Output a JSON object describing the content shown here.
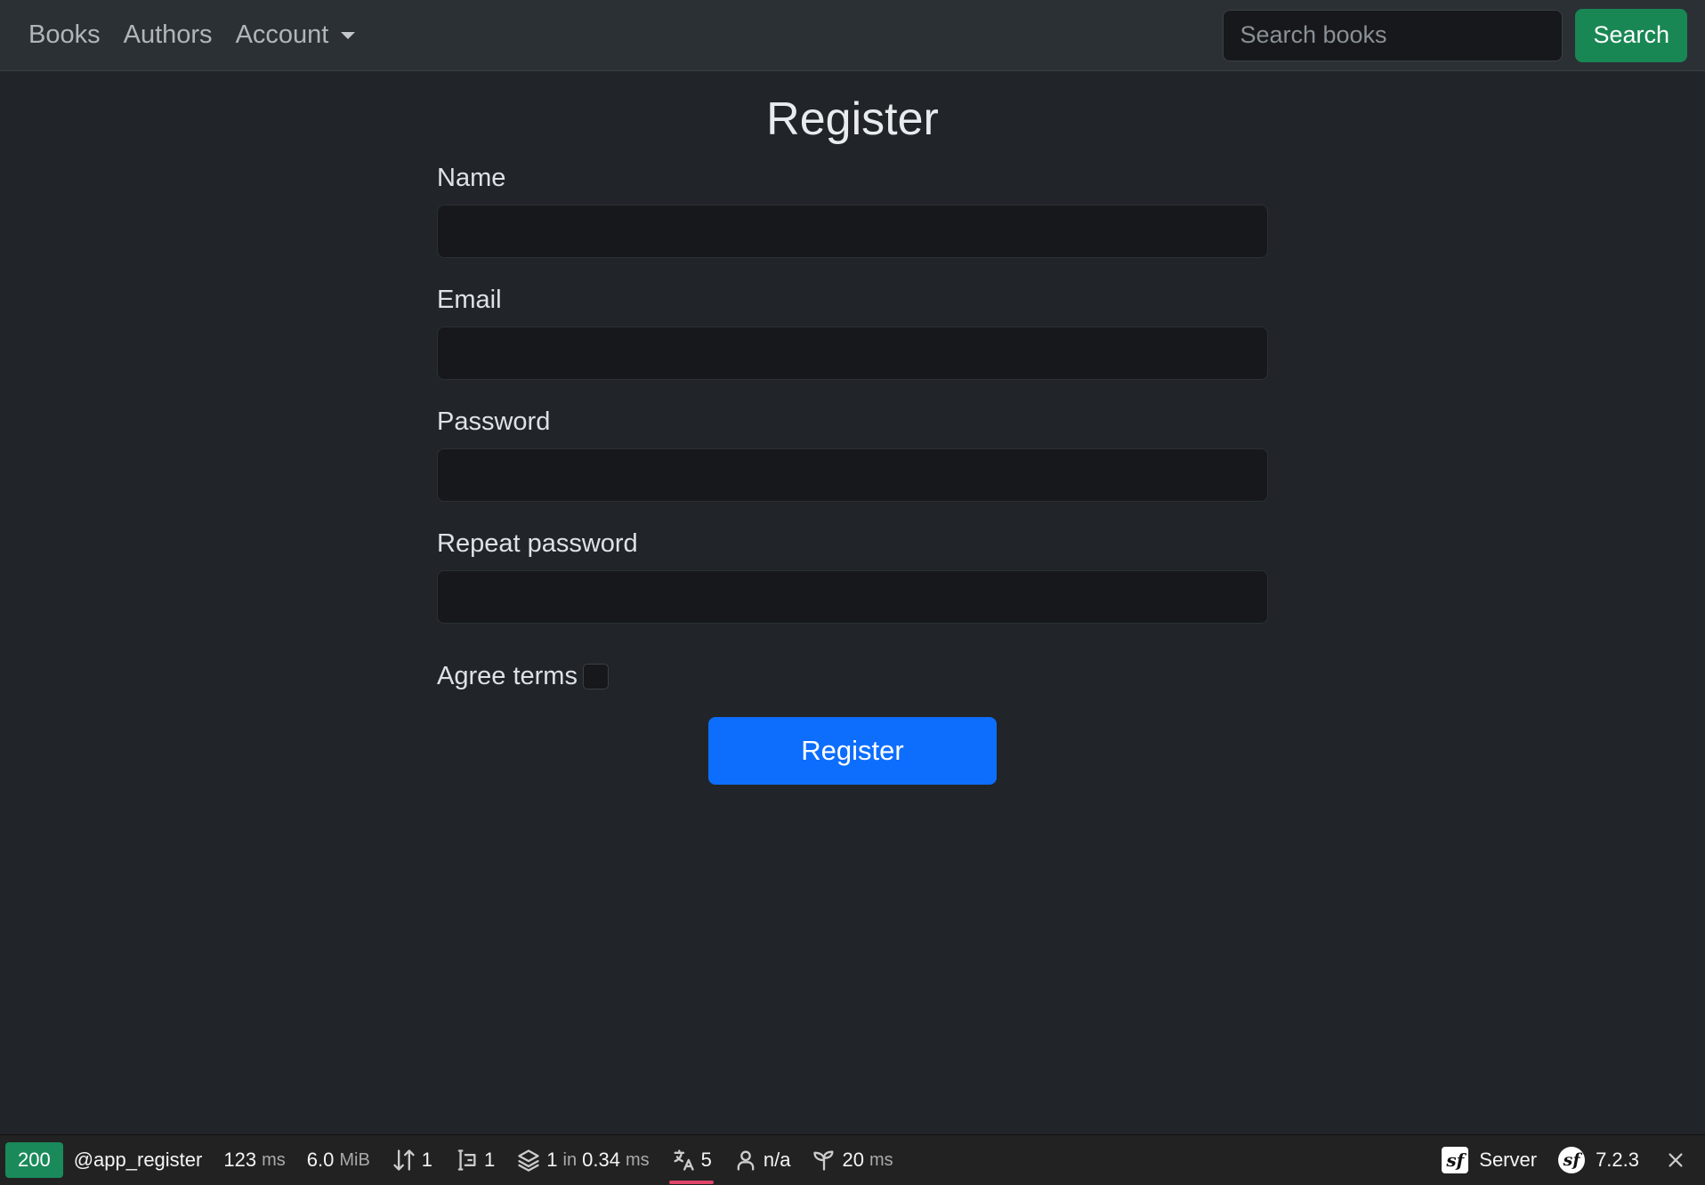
{
  "navbar": {
    "links": [
      {
        "label": "Books"
      },
      {
        "label": "Authors"
      },
      {
        "label": "Account"
      }
    ],
    "search": {
      "placeholder": "Search books",
      "value": ""
    },
    "search_button": "Search"
  },
  "page": {
    "title": "Register"
  },
  "form": {
    "name_label": "Name",
    "email_label": "Email",
    "password_label": "Password",
    "repeat_password_label": "Repeat password",
    "agree_terms_label": "Agree terms",
    "agree_terms_checked": false,
    "submit_label": "Register"
  },
  "toolbar": {
    "status": "200",
    "route": "@app_register",
    "time_value": "123",
    "time_unit": "ms",
    "memory_value": "6.0",
    "memory_unit": "MiB",
    "requests": "1",
    "forms": "1",
    "cache_count": "1",
    "cache_in": "in",
    "cache_time": "0.34",
    "cache_unit": "ms",
    "translations": "5",
    "user": "n/a",
    "twig_value": "20",
    "twig_unit": "ms",
    "server_label": "Server",
    "symfony_version": "7.2.3",
    "sf_logo_text": "sf"
  },
  "colors": {
    "background": "#212529",
    "navbar": "#2b3035",
    "search_button": "#198754",
    "register_button": "#0d6efd",
    "status_badge": "#1a8a5b",
    "active_underline": "#e0456a"
  },
  "icons": [
    "caret-down-icon",
    "requests-icon",
    "form-icon",
    "cache-icon",
    "translation-icon",
    "user-icon",
    "twig-icon",
    "symfony-server-icon",
    "symfony-version-icon",
    "close-icon"
  ]
}
